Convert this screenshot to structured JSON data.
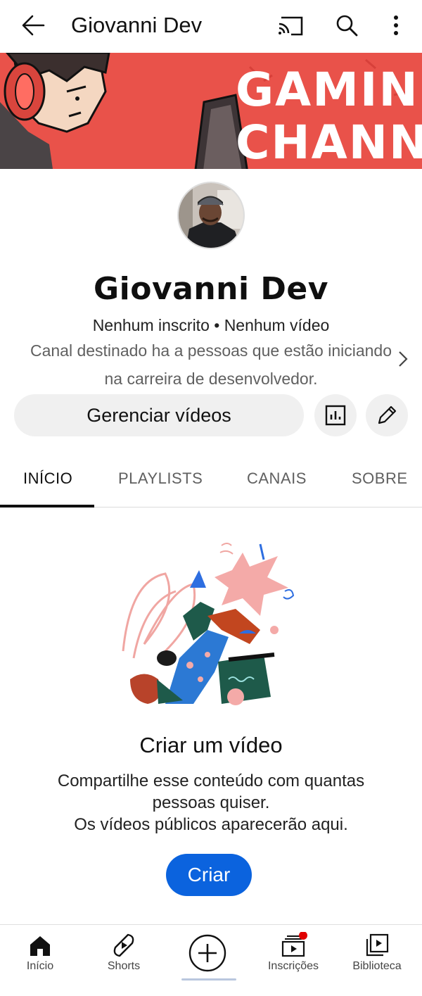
{
  "topbar": {
    "title": "Giovanni Dev",
    "icons": [
      "back-arrow-icon",
      "cast-icon",
      "search-icon",
      "more-vert-icon"
    ]
  },
  "banner": {
    "line1": "GAMIN",
    "line2": "CHANN"
  },
  "channel": {
    "name": "Giovanni Dev",
    "stats": "Nenhum inscrito • Nenhum vídeo",
    "description": "Canal destinado ha a pessoas que estão iniciando na carreira de desenvolvedor."
  },
  "actions": {
    "manage_label": "Gerenciar vídeos",
    "icons": [
      "analytics-icon",
      "edit-pencil-icon"
    ]
  },
  "tabs": [
    {
      "label": "INÍCIO",
      "active": true
    },
    {
      "label": "PLAYLISTS",
      "active": false
    },
    {
      "label": "CANAIS",
      "active": false
    },
    {
      "label": "SOBRE",
      "active": false
    }
  ],
  "empty_state": {
    "title": "Criar um vídeo",
    "line1": "Compartilhe esse conteúdo com quantas",
    "line2": "pessoas quiser.",
    "line3": "Os vídeos públicos aparecerão aqui.",
    "button": "Criar"
  },
  "bottom_nav": [
    {
      "label": "Início",
      "icon": "home-icon"
    },
    {
      "label": "Shorts",
      "icon": "shorts-icon"
    },
    {
      "label": "",
      "icon": "create-plus-icon"
    },
    {
      "label": "Inscrições",
      "icon": "subscriptions-icon"
    },
    {
      "label": "Biblioteca",
      "icon": "library-icon"
    }
  ],
  "colors": {
    "banner": "#e9524a",
    "accent_blue": "#0b63de",
    "notification_dot": "#e00000"
  }
}
